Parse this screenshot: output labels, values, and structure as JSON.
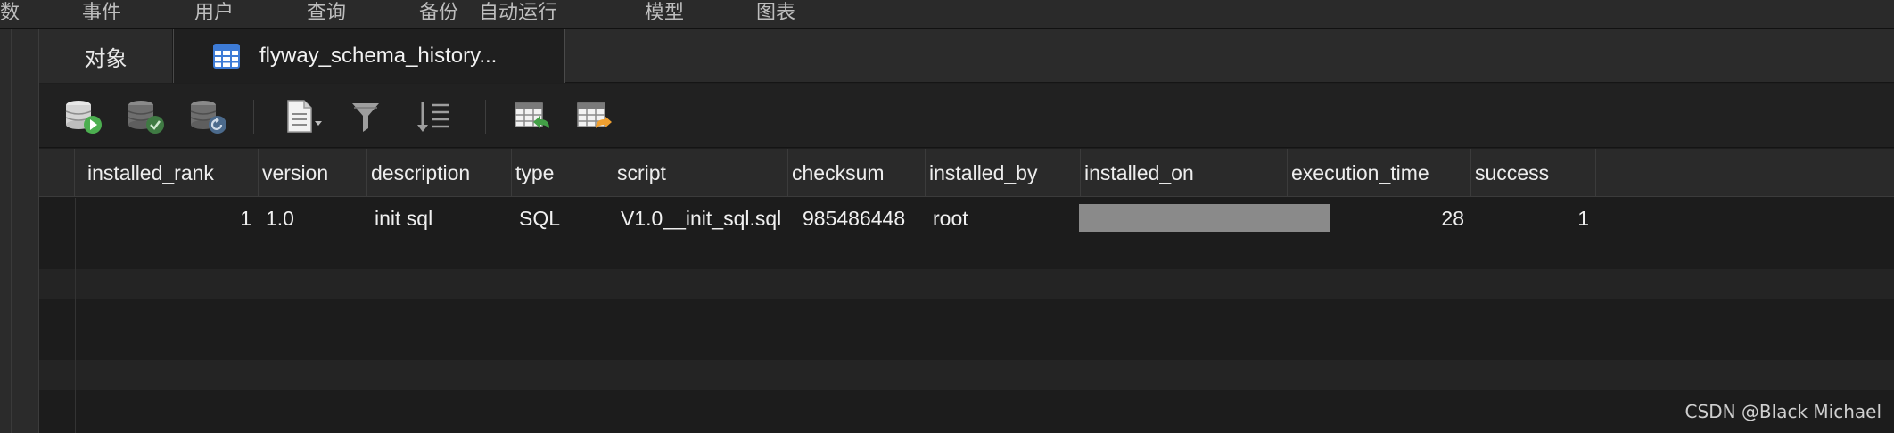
{
  "menu": {
    "items": [
      {
        "label": "数"
      },
      {
        "label": "事件"
      },
      {
        "label": "用户"
      },
      {
        "label": "查询"
      },
      {
        "label": "备份"
      },
      {
        "label": "自动运行"
      },
      {
        "label": "模型"
      },
      {
        "label": "图表"
      }
    ]
  },
  "tabs": {
    "objects_label": "对象",
    "table_label": "flyway_schema_history..."
  },
  "toolbar": {
    "icons": [
      "start-transaction-icon",
      "commit-icon",
      "rollback-icon",
      "text-view-icon",
      "filter-icon",
      "sort-icon",
      "import-icon",
      "export-icon"
    ]
  },
  "grid": {
    "columns": [
      "installed_rank",
      "version",
      "description",
      "type",
      "script",
      "checksum",
      "installed_by",
      "installed_on",
      "execution_time",
      "success"
    ],
    "rows": [
      {
        "installed_rank": "1",
        "version": "1.0",
        "description": "init sql",
        "type": "SQL",
        "script": "V1.0__init_sql.sql",
        "checksum": "985486448",
        "installed_by": "root",
        "installed_on": "",
        "execution_time": "28",
        "success": "1"
      }
    ],
    "redacted_color": "#8a8a8a"
  },
  "watermark": "CSDN @Black Michael"
}
